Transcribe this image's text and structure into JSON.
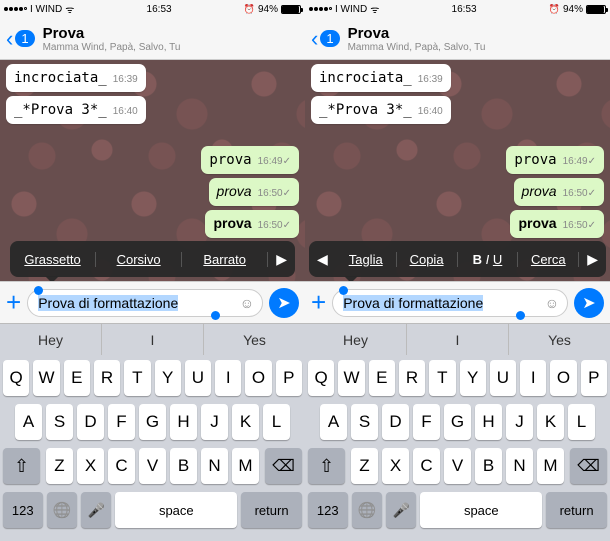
{
  "status": {
    "carrier": "I WIND",
    "time": "16:53",
    "battery": "94%"
  },
  "header": {
    "back_count": "1",
    "chat_name": "Prova",
    "members": "Mamma Wind, Papà, Salvo, Tu"
  },
  "messages": {
    "in1_text": "incrociata_",
    "in1_time": "16:39",
    "in2_text": "_*Prova 3*_",
    "in2_time": "16:40",
    "out1_text": "prova",
    "out1_time": "16:49",
    "out2_text": "prova",
    "out2_time": "16:50",
    "out3_text": "prova",
    "out3_time": "16:50"
  },
  "menu_left": {
    "item1": "Grassetto",
    "item2": "Corsivo",
    "item3": "Barrato"
  },
  "menu_right": {
    "item1": "Taglia",
    "item2": "Copia",
    "item3_b": "B",
    "item3_i": "I",
    "item3_u": "U",
    "item4": "Cerca"
  },
  "input": {
    "text": "Prova di formattazione"
  },
  "suggestions": {
    "s1": "Hey",
    "s2": "I",
    "s3": "Yes"
  },
  "keyboard": {
    "r1": [
      "Q",
      "W",
      "E",
      "R",
      "T",
      "Y",
      "U",
      "I",
      "O",
      "P"
    ],
    "r2": [
      "A",
      "S",
      "D",
      "F",
      "G",
      "H",
      "J",
      "K",
      "L"
    ],
    "r3": [
      "Z",
      "X",
      "C",
      "V",
      "B",
      "N",
      "M"
    ],
    "num": "123",
    "space": "space",
    "return": "return"
  }
}
